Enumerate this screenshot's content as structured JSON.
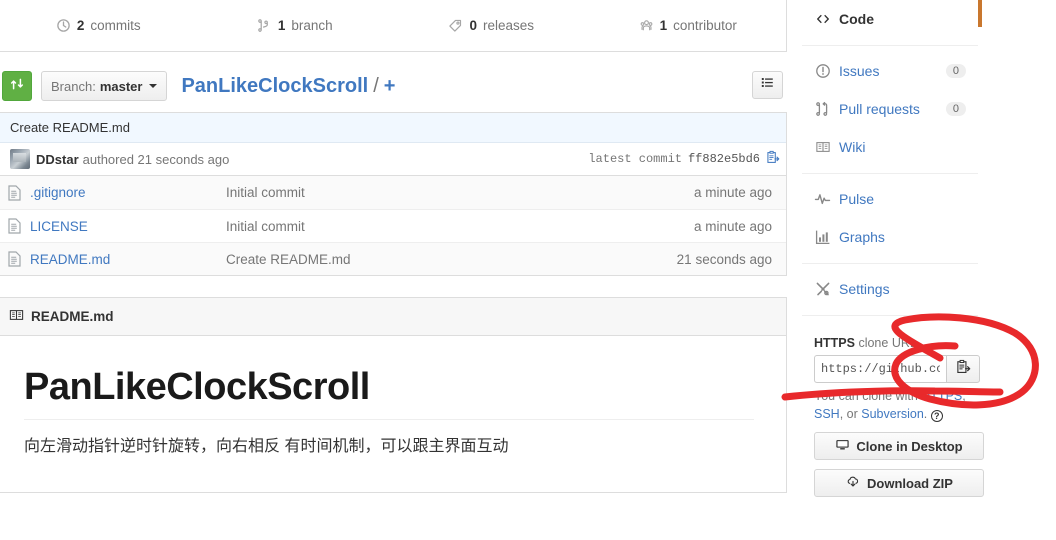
{
  "stats": [
    {
      "icon": "commits-icon",
      "count": "2",
      "label": "commits"
    },
    {
      "icon": "branch-icon",
      "count": "1",
      "label": "branch"
    },
    {
      "icon": "tag-icon",
      "count": "0",
      "label": "releases"
    },
    {
      "icon": "people-icon",
      "count": "1",
      "label": "contributor"
    }
  ],
  "file_nav": {
    "compare_icon": "compare-icon",
    "branch_label": "Branch:",
    "branch_value": "master",
    "repo_name": "PanLikeClockScroll",
    "separator": "/",
    "add_file": "+",
    "find_file_icon": "list-icon"
  },
  "commit_tease": {
    "message": "Create README.md",
    "author": "DDstar",
    "meta": "authored 21 seconds ago",
    "latest_commit_label": "latest commit",
    "sha": "ff882e5bd6",
    "copy_icon": "clipboard-icon"
  },
  "files": [
    {
      "icon": "file-icon",
      "name": ".gitignore",
      "message": "Initial commit",
      "age": "a minute ago"
    },
    {
      "icon": "file-icon",
      "name": "LICENSE",
      "message": "Initial commit",
      "age": "a minute ago"
    },
    {
      "icon": "file-icon",
      "name": "README.md",
      "message": "Create README.md",
      "age": "21 seconds ago"
    }
  ],
  "readme": {
    "header_icon": "book-icon",
    "header_title": "README.md",
    "heading": "PanLikeClockScroll",
    "paragraph": "向左滑动指针逆时针旋转，向右相反 有时间机制，可以跟主界面互动"
  },
  "sidebar": {
    "nav": [
      {
        "icon": "code-icon",
        "label": "Code",
        "counter": null,
        "active": true
      },
      {
        "icon": "issue-opened-icon",
        "label": "Issues",
        "counter": "0",
        "active": false
      },
      {
        "icon": "pull-request-icon",
        "label": "Pull requests",
        "counter": "0",
        "active": false
      },
      {
        "icon": "book-icon",
        "label": "Wiki",
        "counter": null,
        "active": false
      },
      {
        "icon": "pulse-icon",
        "label": "Pulse",
        "counter": null,
        "active": false
      },
      {
        "icon": "graph-icon",
        "label": "Graphs",
        "counter": null,
        "active": false
      },
      {
        "icon": "tools-icon",
        "label": "Settings",
        "counter": null,
        "active": false
      }
    ],
    "clone": {
      "protocol": "HTTPS",
      "label_rest": " clone URL",
      "url_value": "https://github.com/DDstar/PanLikeClockScroll.git",
      "copy_icon": "clipboard-icon",
      "help_line1": "You can clone with ",
      "help_https": "HTTPS",
      "help_comma": ", ",
      "help_ssh": "SSH",
      "help_or": ", or ",
      "help_svn": "Subversion",
      "help_end": ". ",
      "help_icon": "question-icon",
      "clone_desktop_label": "Clone in Desktop",
      "clone_desktop_icon": "desktop-icon",
      "download_zip_label": "Download ZIP",
      "download_zip_icon": "cloud-download-icon"
    }
  },
  "annotation": {
    "type": "red-hand-drawn-highlight",
    "color": "#e8292b",
    "targets": [
      "clone-url-copy-button",
      "clone-url-input"
    ]
  },
  "colors": {
    "link": "#4078c0",
    "muted": "#767676",
    "green": "#60b044",
    "active_tab_bar": "#c9772e",
    "commit_banner": "#f1f8ff",
    "annotation_red": "#e8292b"
  }
}
